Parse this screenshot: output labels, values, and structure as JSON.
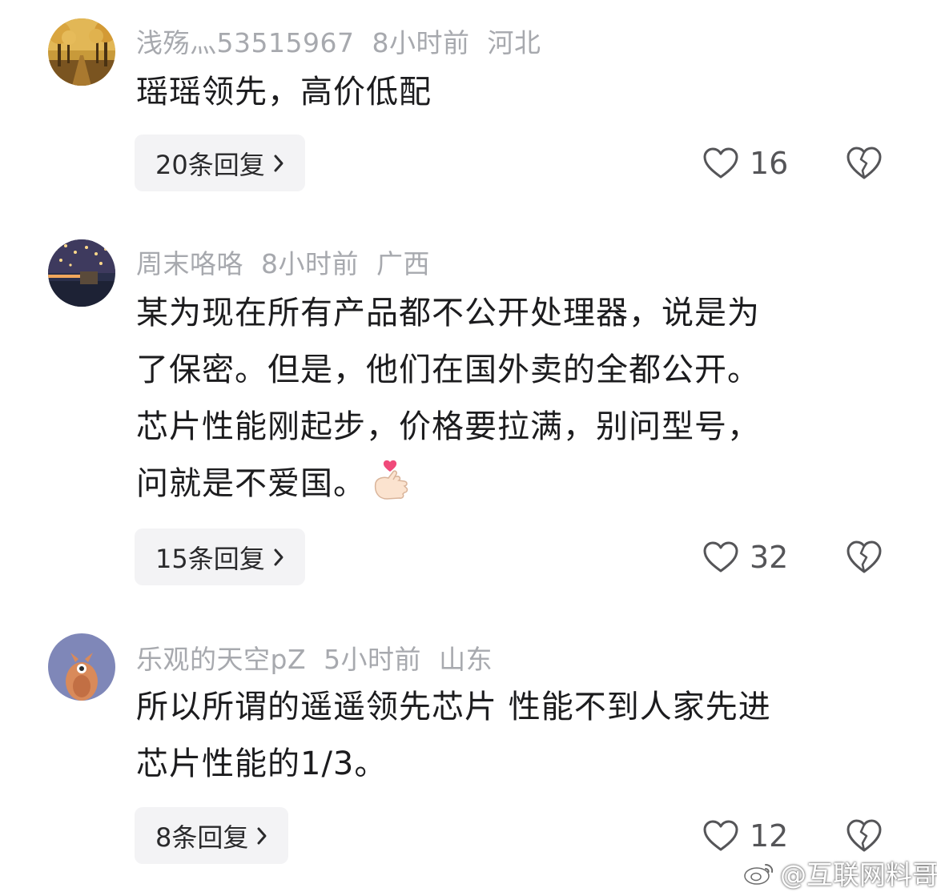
{
  "comments": [
    {
      "username": "浅殇灬53515967",
      "time": "8小时前",
      "location": "河北",
      "lines": [
        "瑶瑶领先，高价低配"
      ],
      "reply_label": "20条回复",
      "likes": "16",
      "avatar_icon": "autumn-trees-avatar"
    },
    {
      "username": "周末咯咯",
      "time": "8小时前",
      "location": "广西",
      "lines": [
        "某为现在所有产品都不公开处理器，说是为",
        "了保密。但是，他们在国外卖的全都公开。",
        "芯片性能刚起步，价格要拉满，别问型号，",
        "问就是不爱国。"
      ],
      "reply_label": "15条回复",
      "likes": "32",
      "avatar_icon": "night-lanterns-avatar",
      "emoji": "finger-heart-emoji"
    },
    {
      "username": "乐观的天空pZ",
      "time": "5小时前",
      "location": "山东",
      "lines": [
        "所以所谓的遥遥领先芯片 性能不到人家先进",
        "芯片性能的1/3。"
      ],
      "reply_label": "8条回复",
      "likes": "12",
      "avatar_icon": "cartoon-creature-avatar"
    }
  ],
  "watermark": "@互联网料哥",
  "colors": {
    "meta_text": "#a7a9ae",
    "body_text": "#1c1c1e",
    "reply_bg": "#f3f3f5",
    "like_text": "#555558"
  },
  "icons": [
    "heart-icon",
    "broken-heart-icon",
    "chevron-right-icon",
    "weibo-icon"
  ]
}
